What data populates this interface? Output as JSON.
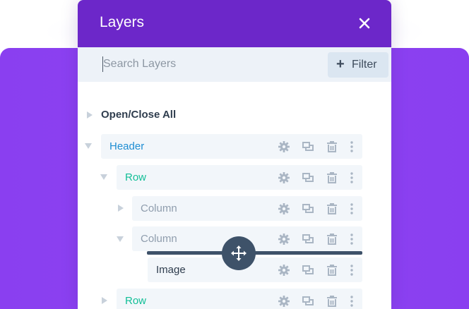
{
  "panel": {
    "title": "Layers",
    "close_icon": "close-icon"
  },
  "search": {
    "placeholder": "Search Layers",
    "value": ""
  },
  "filter": {
    "label": "Filter",
    "icon": "plus-icon"
  },
  "open_close_all": {
    "label": "Open/Close All"
  },
  "layers": [
    {
      "label": "Header",
      "type": "section",
      "expanded": true,
      "color": "#1f8ed3"
    },
    {
      "label": "Row",
      "type": "row",
      "expanded": true,
      "color": "#12bf97"
    },
    {
      "label": "Column",
      "type": "column",
      "expanded": false,
      "color": "#8f9dad"
    },
    {
      "label": "Column",
      "type": "column",
      "expanded": true,
      "color": "#8f9dad"
    },
    {
      "label": "Image",
      "type": "module",
      "expanded": false,
      "color": "#2f3d4e"
    },
    {
      "label": "Row",
      "type": "row",
      "expanded": false,
      "color": "#12bf97"
    }
  ],
  "row_actions": [
    "gear-icon",
    "duplicate-icon",
    "trash-icon",
    "more-icon"
  ],
  "colors": {
    "header_purple": "#6c27c9",
    "background_purple": "#8a3ff0",
    "search_bg": "#edf2f8",
    "row_bg": "#f2f6fa",
    "drag_color": "#3e5269"
  }
}
